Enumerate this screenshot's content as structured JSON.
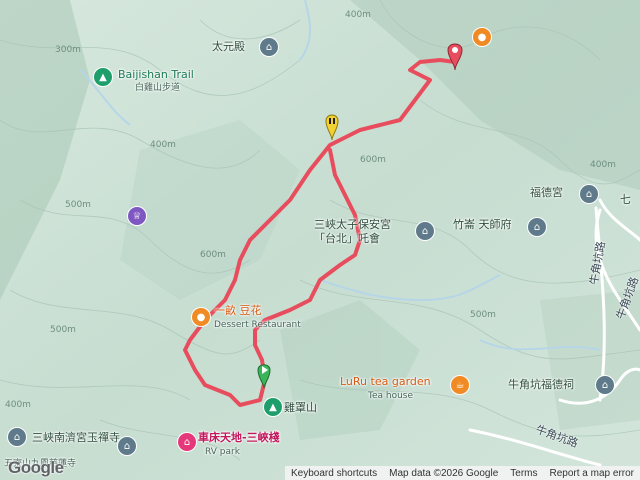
{
  "map": {
    "poi": {
      "baijishan_trail": "Baijishan Trail",
      "baijishan_trail_zh": "白雞山步道",
      "taiyuan_hall": "太元殿",
      "fude_temple": "福德宮",
      "qi": "七",
      "zhuqi_tianshi": "竹崙 天師府",
      "sanxia_taishan_line1": "三峽太子保安宮",
      "sanxia_taishan_line2": "「台北」吒會",
      "yimu_douhua": "一畝 豆花",
      "yimu_douhua_sub": "Dessert Restaurant",
      "luru_tea_garden": "LuRu tea garden",
      "luru_tea_garden_sub": "Tea house",
      "jicui_mountain": "雞罩山",
      "niujiaokeng_fude": "牛角坑福德祠",
      "sanxia_nanji": "三峽南濟宮玉禪寺",
      "chechuang_tiandi": "車床天地-三峽棧",
      "chechuang_sub": "RV park",
      "wuhang_ciliansi": "五寮山九鳳慈蓮寺",
      "niujiaokeng_road": "牛角坑路",
      "niujiaokeng_road2": "牛角坑路",
      "niujiaokeng_road3": "牛角坑路"
    },
    "contours": [
      "300m",
      "400m",
      "400m",
      "500m",
      "600m",
      "500m",
      "600m",
      "500m",
      "400m",
      "400m"
    ],
    "footer": {
      "shortcuts": "Keyboard shortcuts",
      "map_data": "Map data ©2026 Google",
      "terms": "Terms",
      "report": "Report a map error"
    },
    "logo": "Google",
    "colors": {
      "route": "#e84d5e",
      "terrain": "#cfe3d9",
      "river": "#b7d7ea",
      "road": "#ffffff"
    }
  }
}
